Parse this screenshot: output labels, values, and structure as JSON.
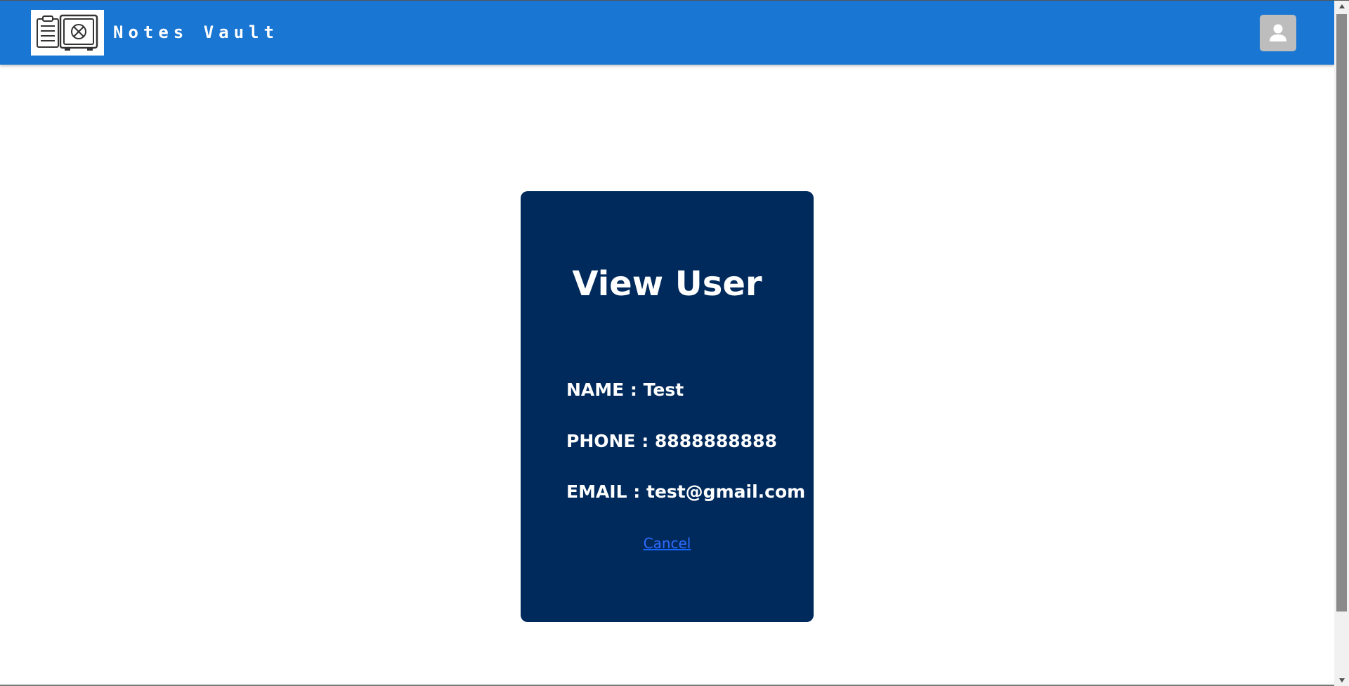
{
  "header": {
    "brand": "Notes Vault",
    "logo_icon": "notes-safe-logo",
    "avatar_icon": "person-icon",
    "bar_color": "#1976d2"
  },
  "card": {
    "title": "View User",
    "fields": [
      {
        "key": "name",
        "text": "NAME : Test"
      },
      {
        "key": "phone",
        "text": "PHONE : 8888888888"
      },
      {
        "key": "email",
        "text": "EMAIL : test@gmail.com"
      }
    ],
    "cancel_label": "Cancel",
    "background": "#002a5c"
  }
}
